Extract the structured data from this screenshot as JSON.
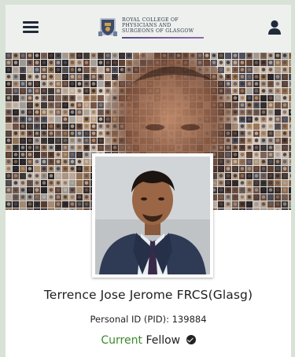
{
  "header": {
    "logo_lines": [
      "ROYAL COLLEGE OF",
      "PHYSICIANS AND",
      "SURGEONS OF GLASGOW"
    ],
    "menu_icon": "hamburger-menu-icon",
    "user_icon": "user-icon"
  },
  "profile": {
    "name": "Terrence Jose Jerome FRCS(Glasg)",
    "pid": "Personal ID (PID): 139884",
    "status_word": "Current",
    "status_label": "Fellow"
  },
  "colors": {
    "status_green": "#3a8a2a",
    "logo_navy": "#2c3547",
    "topbar_bg": "#eef0ed"
  }
}
